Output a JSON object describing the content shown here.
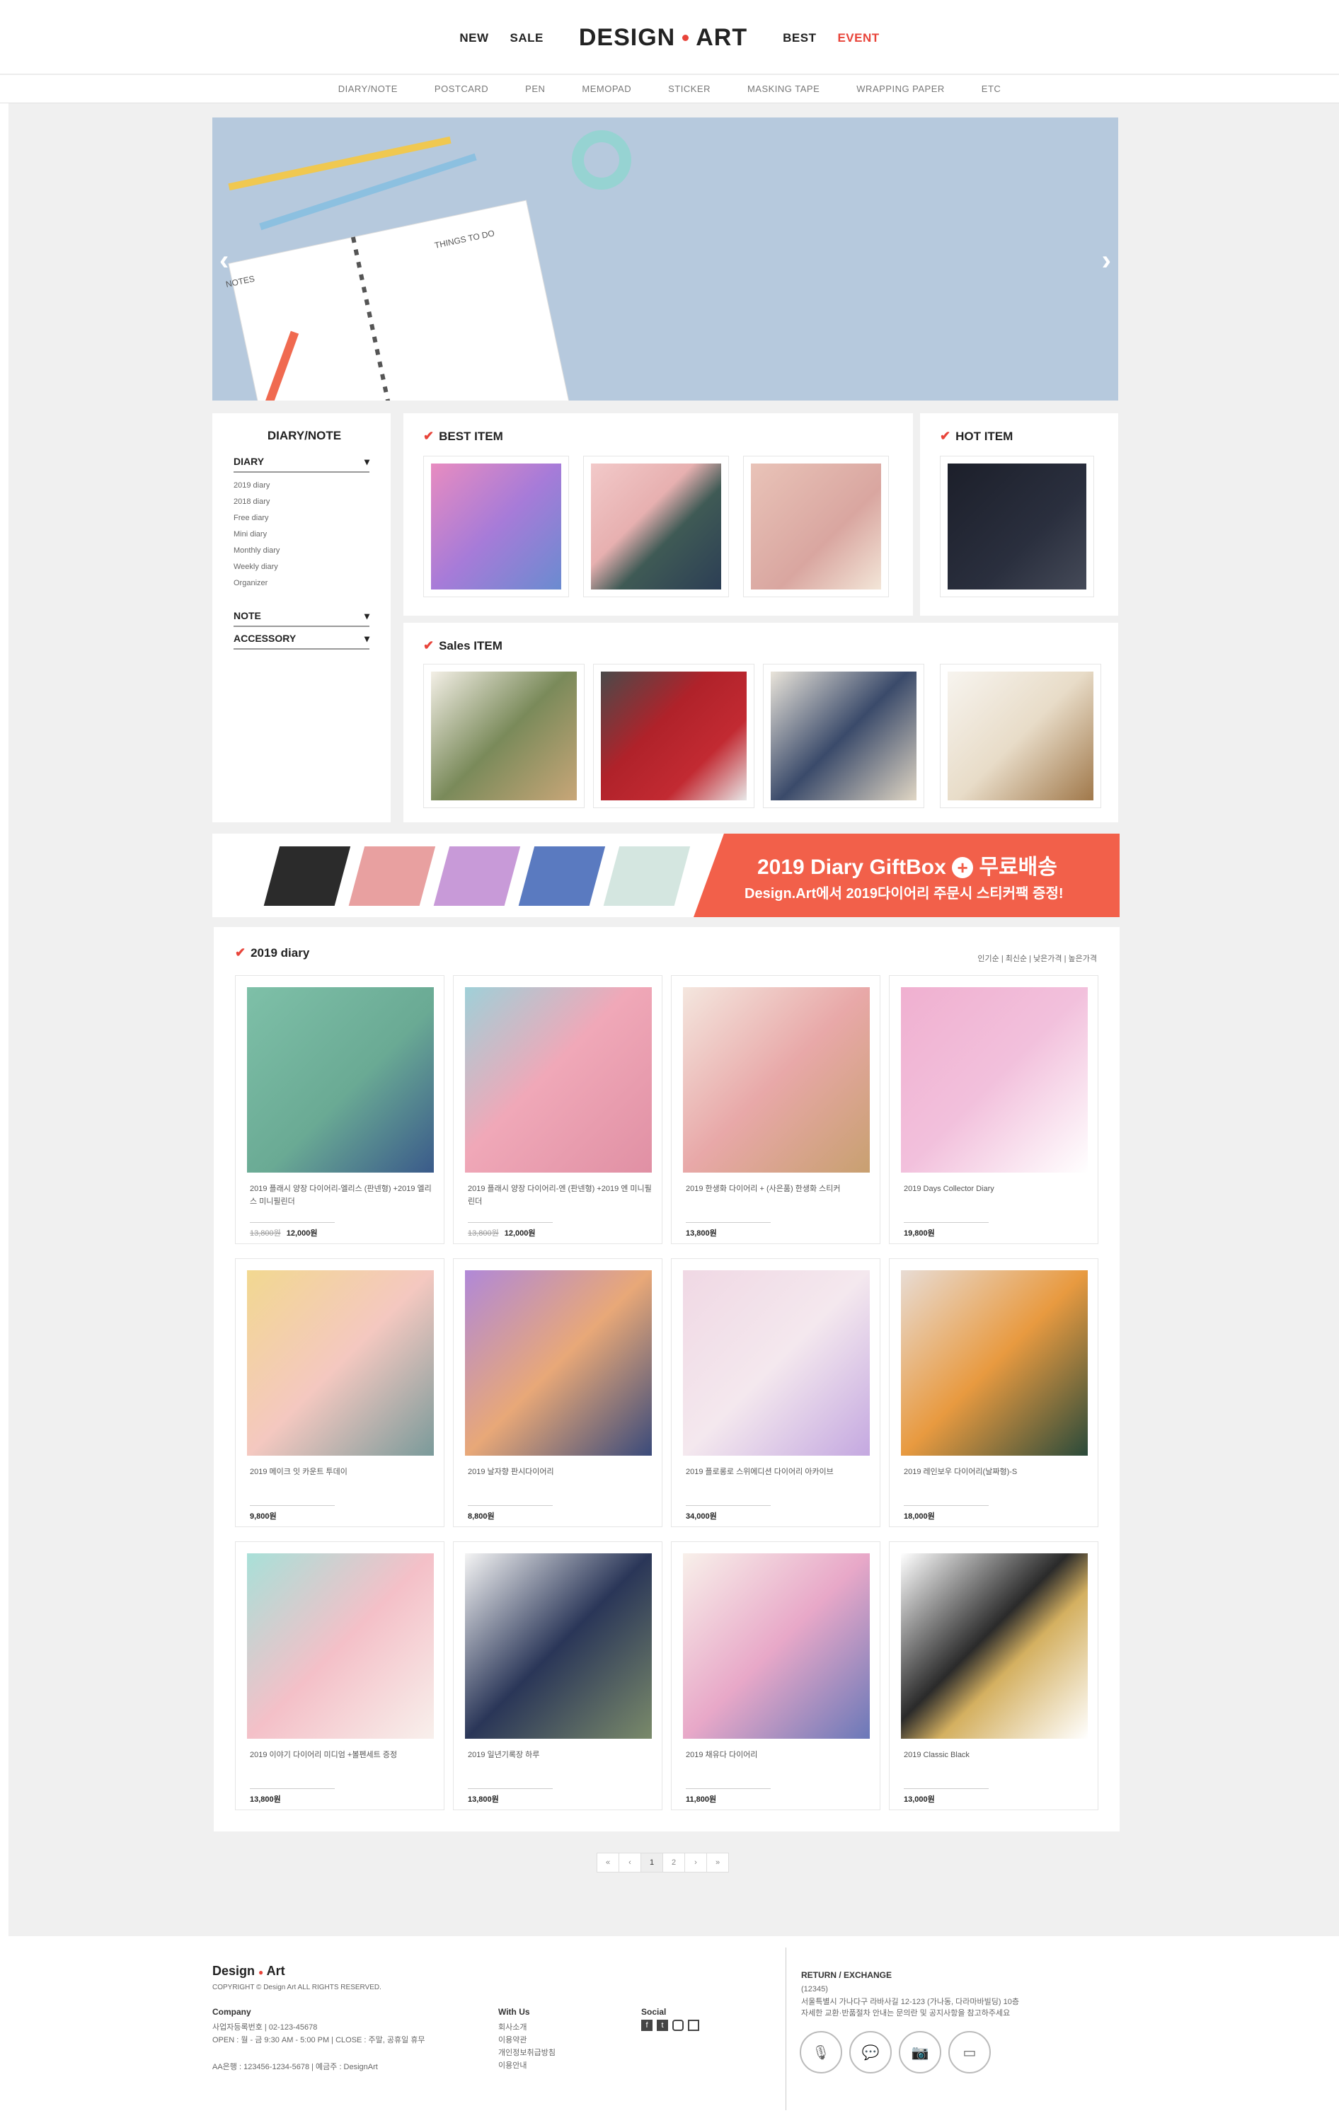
{
  "header": {
    "nav": [
      "NEW",
      "SALE"
    ],
    "logo_left": "DESIGN",
    "logo_right": "ART",
    "nav_right": [
      "BEST",
      "EVENT"
    ]
  },
  "categories": [
    "DIARY/NOTE",
    "POSTCARD",
    "PEN",
    "MEMOPAD",
    "STICKER",
    "MASKING TAPE",
    "WRAPPING PAPER",
    "ETC"
  ],
  "hero": {
    "notes": "NOTES",
    "things": "THINGS TO DO"
  },
  "sidebar": {
    "title": "DIARY/NOTE",
    "diary": "DIARY",
    "items": [
      "2019 diary",
      "2018 diary",
      "Free diary",
      "Mini diary",
      "Monthly diary",
      "Weekly diary",
      "Organizer"
    ],
    "note": "NOTE",
    "accessory": "ACCESSORY"
  },
  "best": {
    "title": "BEST ITEM"
  },
  "hot": {
    "title": "HOT ITEM"
  },
  "sales": {
    "title": "Sales ITEM"
  },
  "banner": {
    "line1": "2019 Diary GiftBox",
    "plus": "+",
    "line1b": "무료배송",
    "line2": "Design.Art에서 2019다이어리 주문시 스티커팩 증정!"
  },
  "list": {
    "title": "2019 diary",
    "sort": "인기순 | 최신순 | 낮은가격 | 높은가격",
    "products": [
      {
        "name": "2019 플래시 양장 다이어리-엘리스 (판넨형) +2019 엘리스 미니필린더",
        "old": "13,800원",
        "price": "12,000원"
      },
      {
        "name": "2019 플래시 양장 다이어리-엔 (판넨형) +2019 엔 미니필린더",
        "old": "13,800원",
        "price": "12,000원"
      },
      {
        "name": "2019 한생화 다이어리 + (사은품) 한생화 스티커",
        "old": "",
        "price": "13,800원"
      },
      {
        "name": "2019 Days Collector Diary",
        "old": "",
        "price": "19,800원"
      },
      {
        "name": "2019 메이크 잇 카운트 투데이",
        "old": "",
        "price": "9,800원"
      },
      {
        "name": "2019 날자향 판시다이어리",
        "old": "",
        "price": "8,800원"
      },
      {
        "name": "2019 플로롱로 스위에디션 다이어리 아카이브",
        "old": "",
        "price": "34,000원"
      },
      {
        "name": "2019 레인보우 다이어리(날짜형)-S",
        "old": "",
        "price": "18,000원"
      },
      {
        "name": "2019 이야기 다이어리 미디엄 +볼펜세트 증정",
        "old": "",
        "price": "13,800원"
      },
      {
        "name": "2019 일년기록장 하루",
        "old": "",
        "price": "13,800원"
      },
      {
        "name": "2019 채유다 다이어리",
        "old": "",
        "price": "11,800원"
      },
      {
        "name": "2019 Classic Black",
        "old": "",
        "price": "13,000원"
      }
    ]
  },
  "pager": [
    "«",
    "‹",
    "1",
    "2",
    "›",
    "»"
  ],
  "footer": {
    "brand_left": "Design",
    "brand_right": "Art",
    "copyright": "COPYRIGHT © Design Art ALL RIGHTS RESERVED.",
    "company": "Company",
    "company_l1": "사업자등록번호 | 02-123-45678",
    "company_l2": "OPEN : 월 - 금 9:30 AM - 5:00 PM | CLOSE : 주말, 공휴일 휴무",
    "company_l3": "AA은행 : 123456-1234-5678 | 예금주 : DesignArt",
    "with": "With Us",
    "with_items": [
      "회사소개",
      "이용약관",
      "개인정보취급방침",
      "이용안내"
    ],
    "social": "Social",
    "return": "RETURN / EXCHANGE",
    "ret_l1": "(12345)",
    "ret_l2": "서울특별시 가나다구 라바사길 12-123 (가나동, 다라마바빌딩) 10층",
    "ret_l3": "자세한 교환·반품절차 안내는 문의란 및 공지사항을 참고하주세요"
  },
  "colors": {
    "accent": "#e8443a",
    "banner": "#f2604a"
  }
}
